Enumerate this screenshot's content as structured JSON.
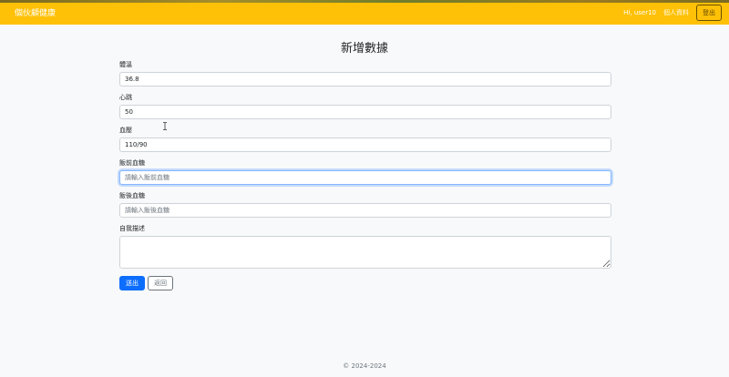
{
  "navbar": {
    "brand": "個伙顧健康",
    "greeting": "Hi, user10",
    "profile_link": "個人資料",
    "logout_label": "登出",
    "color": "#ffc107"
  },
  "page": {
    "title": "新增數據"
  },
  "form": {
    "temperature": {
      "label": "體溫",
      "value": "36.8",
      "placeholder": ""
    },
    "heart_rate": {
      "label": "心跳",
      "value": "50",
      "placeholder": ""
    },
    "blood_pressure": {
      "label": "血壓",
      "value": "110/90",
      "placeholder": ""
    },
    "pre_meal_glucose": {
      "label": "飯前血糖",
      "value": "",
      "placeholder": "請輸入飯前血糖"
    },
    "post_meal_glucose": {
      "label": "飯後血糖",
      "value": "",
      "placeholder": "請輸入飯後血糖"
    },
    "self_description": {
      "label": "自我描述",
      "value": ""
    },
    "submit_label": "送出",
    "back_label": "返回"
  },
  "footer": {
    "copyright": "© 2024-2024"
  },
  "icons": {
    "text_cursor": "i-beam-cursor-icon"
  }
}
